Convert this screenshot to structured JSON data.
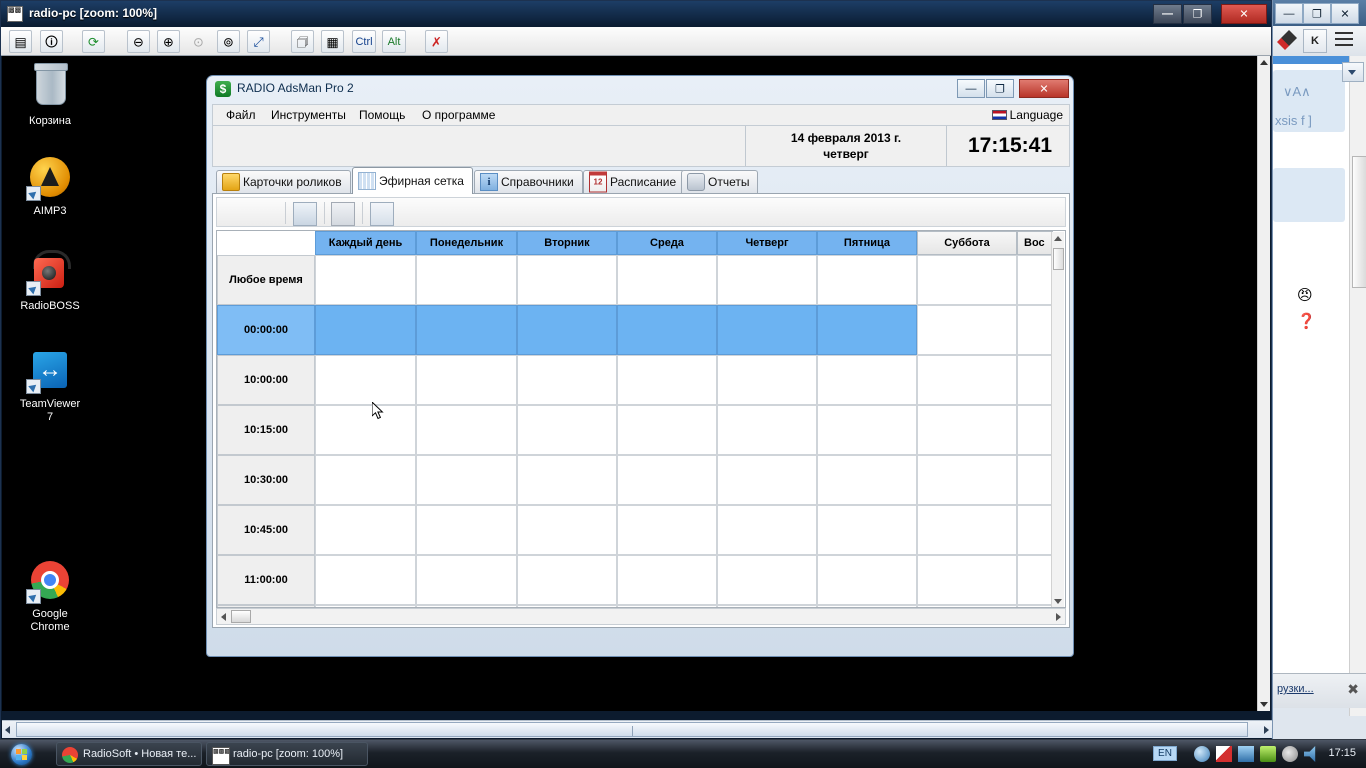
{
  "vnc_window": {
    "title": "radio-pc [zoom: 100%]",
    "icon": "vnc-icon",
    "buttons": {
      "minimize": "—",
      "maximize": "❐",
      "close": "✕"
    },
    "toolbar": [
      {
        "name": "connection-options-icon",
        "glyph": "▤"
      },
      {
        "name": "connection-info-icon",
        "glyph": "🛈"
      },
      {
        "name": "refresh-icon",
        "glyph": "⟳"
      },
      {
        "name": "zoom-out-icon",
        "glyph": "⊖"
      },
      {
        "name": "zoom-in-icon",
        "glyph": "⊕"
      },
      {
        "name": "zoom-100-icon",
        "glyph": "⊙"
      },
      {
        "name": "zoom-fit-icon",
        "glyph": "⊚"
      },
      {
        "name": "fullscreen-icon",
        "glyph": "⤢"
      },
      {
        "name": "send-files-icon",
        "glyph": "🗇"
      },
      {
        "name": "chat-icon",
        "glyph": "▦"
      },
      {
        "name": "ctrl-key",
        "label": "Ctrl"
      },
      {
        "name": "alt-key",
        "label": "Alt"
      },
      {
        "name": "disconnect-icon",
        "glyph": "✗"
      }
    ]
  },
  "desktop": {
    "icons": [
      {
        "name": "recycle-bin",
        "label": "Корзина",
        "shortcut": false
      },
      {
        "name": "aimp3",
        "label": "AIMP3",
        "shortcut": true
      },
      {
        "name": "radioboss",
        "label": "RadioBOSS",
        "shortcut": true
      },
      {
        "name": "teamviewer",
        "label": "TeamViewer\n7",
        "label_l1": "TeamViewer",
        "label_l2": "7",
        "shortcut": true
      },
      {
        "name": "google-chrome",
        "label_l1": "Google",
        "label_l2": "Chrome",
        "shortcut": true
      }
    ]
  },
  "app": {
    "title": "RADIO AdsMan Pro 2",
    "window_buttons": {
      "minimize": "—",
      "maximize": "❐",
      "close": "✕"
    },
    "menu": [
      {
        "label": "Файл"
      },
      {
        "label": "Инструменты"
      },
      {
        "label": "Помощь"
      },
      {
        "label": "О программе"
      }
    ],
    "language_button": "Language",
    "datebar": {
      "date_line1": "14 февраля 2013 г.",
      "date_line2": "четверг",
      "clock": "17:15:41"
    },
    "tabs": [
      {
        "label": "Карточки роликов",
        "icon": "folder-icon",
        "selected": false
      },
      {
        "label": "Эфирная сетка",
        "icon": "grid-icon",
        "selected": true
      },
      {
        "label": "Справочники",
        "icon": "info-icon",
        "selected": false
      },
      {
        "label": "Расписание",
        "icon": "calendar-icon",
        "selected": false
      },
      {
        "label": "Отчеты",
        "icon": "printer-icon",
        "selected": false
      }
    ],
    "toolbar": [
      {
        "name": "new-record-icon",
        "glyph": "✎"
      },
      {
        "name": "delete-record-icon",
        "glyph": "▤"
      },
      {
        "name": "copy-record-icon",
        "glyph": "❐"
      },
      {
        "name": "settings-record-icon",
        "glyph": "▦"
      },
      {
        "name": "preview-icon",
        "glyph": "🔍"
      }
    ],
    "grid": {
      "columns": [
        {
          "label": "",
          "selected": false,
          "blank": true
        },
        {
          "label": "Каждый день",
          "selected": true
        },
        {
          "label": "Понедельник",
          "selected": true
        },
        {
          "label": "Вторник",
          "selected": true
        },
        {
          "label": "Среда",
          "selected": true
        },
        {
          "label": "Четверг",
          "selected": true
        },
        {
          "label": "Пятница",
          "selected": true
        },
        {
          "label": "Суббота",
          "selected": false
        },
        {
          "label": "Вос",
          "selected": false
        }
      ],
      "rows": [
        {
          "label": "Любое время",
          "selected": false
        },
        {
          "label": "00:00:00",
          "selected": true
        },
        {
          "label": "10:00:00",
          "selected": false
        },
        {
          "label": "10:15:00",
          "selected": false
        },
        {
          "label": "10:30:00",
          "selected": false
        },
        {
          "label": "10:45:00",
          "selected": false
        },
        {
          "label": "11:00:00",
          "selected": false
        }
      ],
      "selected_row_index": 1,
      "selected_column_count": 6
    }
  },
  "background_window": {
    "name": "chrome-window",
    "text_fragments": [
      "∨A∧",
      "xsis f ]"
    ],
    "download_label": "рузки...",
    "emoji": [
      "😠",
      "❓"
    ],
    "keyboard_button": "K"
  },
  "taskbar": {
    "start_label": "Start",
    "buttons": [
      {
        "label": "RadioSoft • Новая те...",
        "icon": "chrome-icon"
      },
      {
        "label": "radio-pc [zoom: 100%]",
        "icon": "vnc-icon"
      }
    ],
    "tray": {
      "language": "EN",
      "icons": [
        "show-hidden-icon",
        "antivirus-icon",
        "network-icon",
        "security-icon",
        "sync-icon",
        "volume-icon"
      ],
      "clock": "17:15"
    }
  },
  "colors": {
    "accent_blue": "#6cb3f2",
    "header_blue": "#74b3f0",
    "title_blue": "#1d3e66",
    "close_red": "#b8352a"
  }
}
